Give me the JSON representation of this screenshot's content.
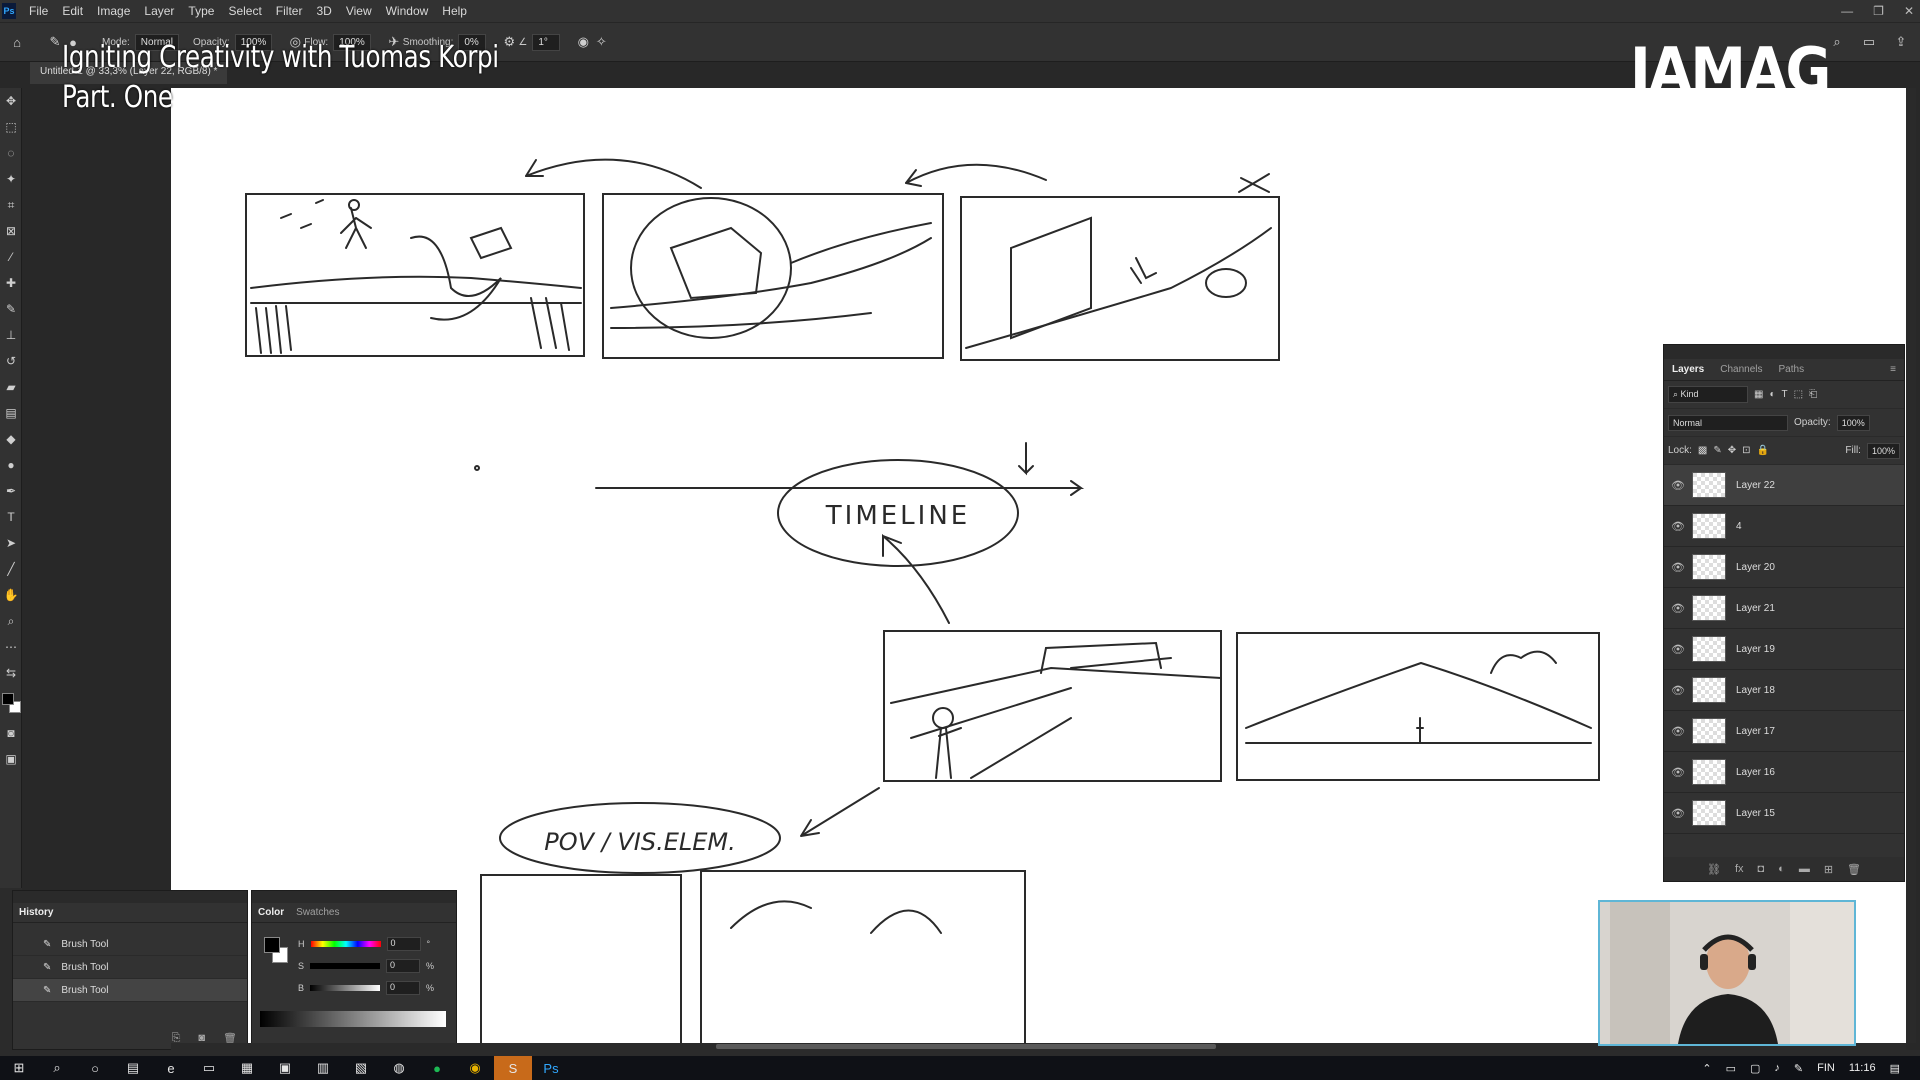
{
  "app": {
    "menu": [
      "File",
      "Edit",
      "Image",
      "Layer",
      "Type",
      "Select",
      "Filter",
      "3D",
      "View",
      "Window",
      "Help"
    ],
    "logo_text": "Ps"
  },
  "options_bar": {
    "mode_label": "Mode:",
    "mode_value": "Normal",
    "opacity_label": "Opacity:",
    "opacity_value": "100%",
    "flow_label": "Flow:",
    "flow_value": "100%",
    "smoothing_label": "Smoothing:",
    "smoothing_value": "0%",
    "angle_value": "1°"
  },
  "document_tab": "Untitled-1 @ 33,3% (Layer 22, RGB/8) *",
  "overlay": {
    "title_line1": "Igniting Creativity with Tuomas Korpi",
    "title_line2": "Part. One",
    "brand": "IAMAG"
  },
  "canvas": {
    "timeline_label": "TIMELINE",
    "pov_label": "POV / VIS.ELEM."
  },
  "layers_panel": {
    "tabs": [
      "Layers",
      "Channels",
      "Paths"
    ],
    "kind_filter": "Kind",
    "blend_mode": "Normal",
    "opacity_label": "Opacity:",
    "opacity_value": "100%",
    "lock_label": "Lock:",
    "fill_label": "Fill:",
    "fill_value": "100%",
    "layers": [
      {
        "name": "Layer 22",
        "selected": true
      },
      {
        "name": "4",
        "selected": false
      },
      {
        "name": "Layer 20",
        "selected": false
      },
      {
        "name": "Layer 21",
        "selected": false
      },
      {
        "name": "Layer 19",
        "selected": false
      },
      {
        "name": "Layer 18",
        "selected": false
      },
      {
        "name": "Layer 17",
        "selected": false
      },
      {
        "name": "Layer 16",
        "selected": false
      },
      {
        "name": "Layer 15",
        "selected": false
      }
    ]
  },
  "history_panel": {
    "tab": "History",
    "items": [
      "Brush Tool",
      "Brush Tool",
      "Brush Tool"
    ]
  },
  "color_panel": {
    "tabs": [
      "Color",
      "Swatches"
    ],
    "h_label": "H",
    "h_value": "0",
    "h_unit": "°",
    "s_label": "S",
    "s_value": "0",
    "s_unit": "%",
    "b_label": "B",
    "b_value": "0",
    "b_unit": "%"
  },
  "taskbar": {
    "lang": "FIN",
    "time": "11:16"
  },
  "colors": {
    "panel_bg": "#323232",
    "canvas_bg": "#ffffff",
    "sketch_ink": "#2a2a2a",
    "webcam_border": "#5fb6d6"
  }
}
